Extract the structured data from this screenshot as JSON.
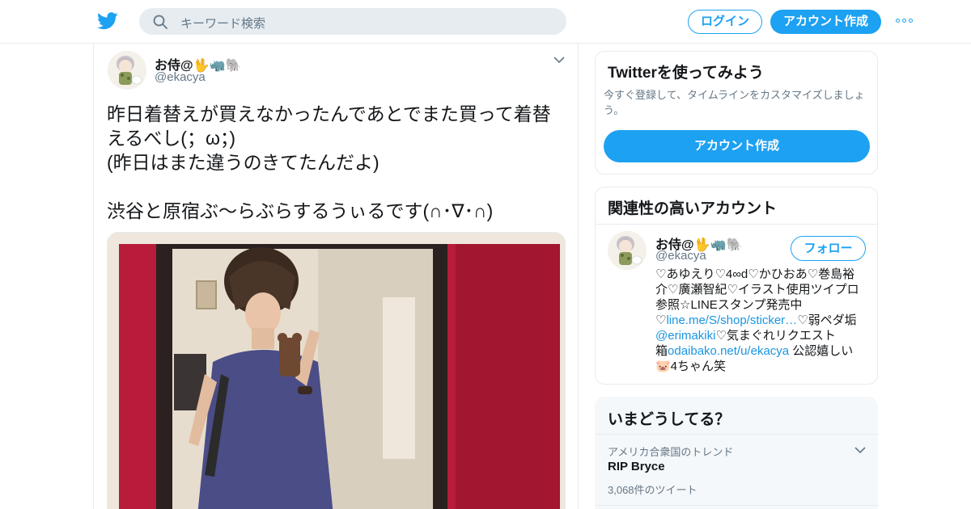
{
  "header": {
    "search_placeholder": "キーワード検索",
    "login_label": "ログイン",
    "signup_label": "アカウント作成",
    "more_icon": "more-dots-icon",
    "accent_color": "#1da1f2"
  },
  "tweet": {
    "author_name": "お侍@🖖🦏🐘",
    "author_handle": "@ekacya",
    "text_lines": [
      "昨日着替えが買えなかったんであとでまた買って着替",
      "えるべし(；ω；)",
      "(昨日はまた違うのきてたんだよ)",
      "",
      "渋谷と原宿ぶ〜らぶらするうぃるです(∩･∇･∩)"
    ]
  },
  "sidebar": {
    "signup_card": {
      "title": "Twitterを使ってみよう",
      "description": "今すぐ登録して、タイムラインをカスタマイズしましょう。",
      "button_label": "アカウント作成"
    },
    "related_card": {
      "title": "関連性の高いアカウント",
      "name": "お侍@🖖🦏🐘",
      "handle": "@ekacya",
      "follow_label": "フォロー",
      "bio": {
        "line1": "♡あゆえり♡4∞d♡かひおあ♡巻島裕",
        "line2": "介♡廣瀬智紀♡イラスト使用ツイプロ",
        "line3": "参照☆LINEスタンプ発売中",
        "line4_pre": "♡",
        "line4_link": "line.me/S/shop/sticker…",
        "line4_post": "♡弱ペダ垢",
        "line5_link": "@erimakiki",
        "line5_post": "♡気まぐれリクエスト",
        "line6_pre": "箱",
        "line6_link": "odaibako.net/u/ekacya",
        "line6_post": " 公認嬉しい",
        "line7": "🐷4ちゃん笑"
      }
    },
    "trends_card": {
      "title": "いまどうしてる？",
      "location": "アメリカ合衆国のトレンド",
      "topic": "RIP Bryce",
      "count": "3,068件のツイート"
    }
  }
}
